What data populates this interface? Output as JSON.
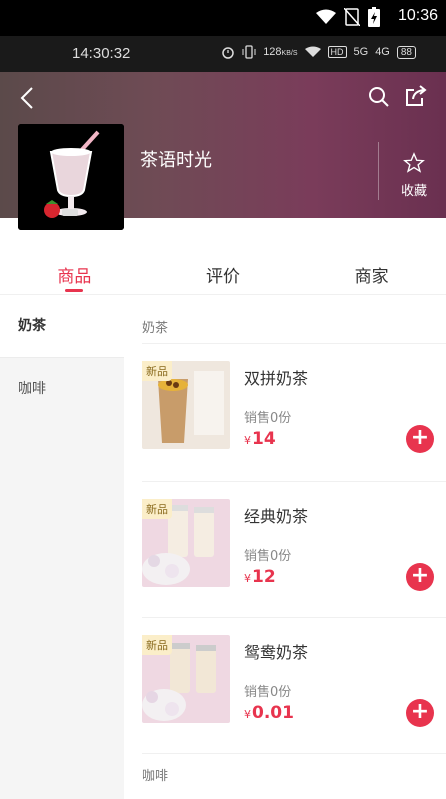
{
  "system": {
    "time": "10:36"
  },
  "phone": {
    "time": "14:30:32",
    "net_speed": "128",
    "net_unit": "KB/S",
    "signal1": "5G",
    "signal2": "4G",
    "hd": "HD",
    "battery": "88"
  },
  "store": {
    "name": "茶语时光",
    "favorite_label": "收藏"
  },
  "tabs": [
    {
      "label": "商品",
      "active": true
    },
    {
      "label": "评价",
      "active": false
    },
    {
      "label": "商家",
      "active": false
    }
  ],
  "categories": [
    {
      "label": "奶茶",
      "active": true
    },
    {
      "label": "咖啡",
      "active": false
    }
  ],
  "sections": [
    {
      "title": "奶茶"
    },
    {
      "title": "咖啡"
    }
  ],
  "products": [
    {
      "badge": "新品",
      "name": "双拼奶茶",
      "sales": "销售0份",
      "currency": "¥",
      "price": "14"
    },
    {
      "badge": "新品",
      "name": "经典奶茶",
      "sales": "销售0份",
      "currency": "¥",
      "price": "12"
    },
    {
      "badge": "新品",
      "name": "鸳鸯奶茶",
      "sales": "销售0份",
      "currency": "¥",
      "price": "0.01"
    }
  ],
  "add_symbol": "+",
  "colors": {
    "accent": "#e8344e",
    "header_start": "#5b4a4a",
    "header_end": "#6a3050",
    "side_bg": "#f5f5f5"
  },
  "icons": [
    "wifi-icon",
    "no-sim-icon",
    "battery-charging-icon",
    "alarm-icon",
    "vibrate-icon",
    "back-icon",
    "search-icon",
    "share-icon",
    "star-icon",
    "add-icon"
  ]
}
